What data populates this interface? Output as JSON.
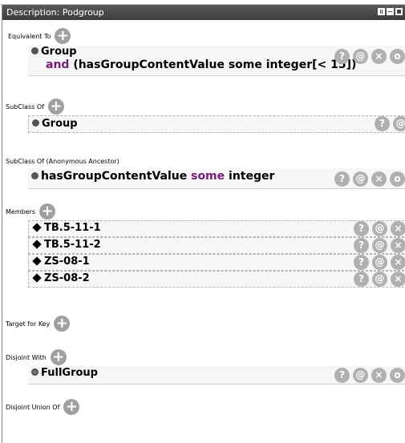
{
  "window": {
    "title": "Description: Podgroup"
  },
  "icons": {
    "add": "+",
    "help": "?",
    "annotate": "@",
    "delete": "×",
    "edit": "o"
  },
  "sections": {
    "equivalent_to": {
      "label": "Equivalent To",
      "items": [
        {
          "line1": "Group",
          "line2_kw": "and",
          "line2_rest": "(hasGroupContentValue some integer[< 15])"
        }
      ]
    },
    "subclass_of": {
      "label": "SubClass Of",
      "items": [
        {
          "text": "Group"
        }
      ]
    },
    "subclass_of_anon": {
      "label": "SubClass Of (Anonymous Ancestor)",
      "items": [
        {
          "prop": "hasGroupContentValue",
          "kw": "some",
          "type": "integer"
        }
      ]
    },
    "members": {
      "label": "Members",
      "items": [
        {
          "text": "TB.5-11-1"
        },
        {
          "text": "TB.5-11-2"
        },
        {
          "text": "ZS-08-1"
        },
        {
          "text": "ZS-08-2"
        }
      ]
    },
    "target_for_key": {
      "label": "Target for Key"
    },
    "disjoint_with": {
      "label": "Disjoint With",
      "items": [
        {
          "text": "FullGroup"
        }
      ]
    },
    "disjoint_union_of": {
      "label": "Disjoint Union Of"
    }
  }
}
